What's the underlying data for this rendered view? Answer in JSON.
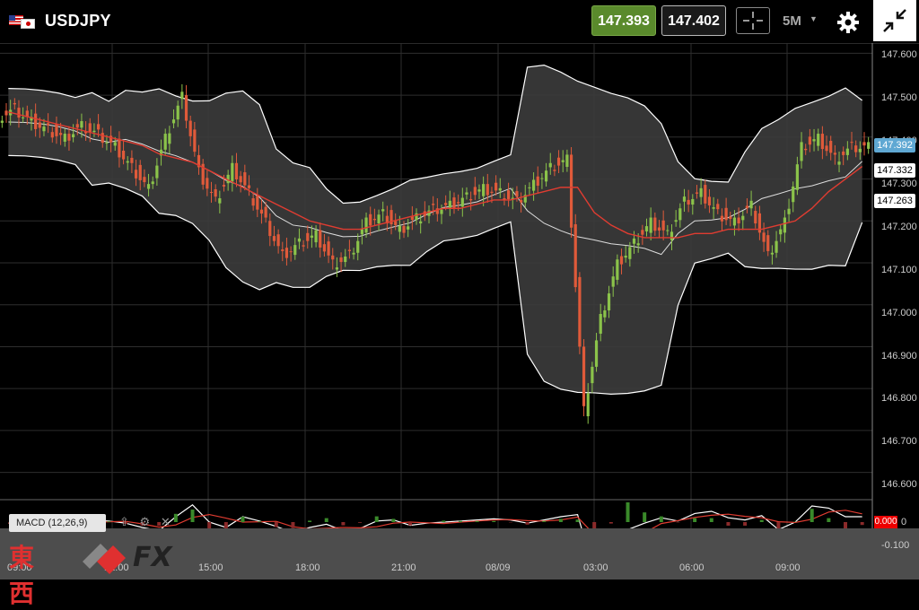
{
  "header": {
    "symbol": "USDJPY",
    "bid_price": "147.393",
    "ask_price": "147.402",
    "interval": "5M"
  },
  "price_axis": {
    "labels": [
      "147.600",
      "147.500",
      "147.400",
      "147.300",
      "147.200",
      "147.100",
      "147.000",
      "146.900",
      "146.800",
      "146.700",
      "146.600"
    ],
    "bid_tag": "147.392",
    "ma_tag": "147.332",
    "lower_band_tag": "147.263"
  },
  "macd": {
    "label": "MACD (12,26,9)",
    "axis_labels": [
      "0",
      "-0.100"
    ],
    "value_tag": "0.000"
  },
  "time_axis": {
    "labels": [
      "09:00",
      "12:00",
      "15:00",
      "18:00",
      "21:00",
      "08/09",
      "03:00",
      "06:00",
      "09:00"
    ]
  },
  "watermark": {
    "kanji": "東西",
    "fx": "FX"
  },
  "colors": {
    "bid": "#5a8a2c",
    "up_candle": "#8bc34a",
    "down_candle": "#e05a3a",
    "ma": "#e03c31",
    "band": "#ffffff"
  },
  "chart_data": {
    "type": "candlestick",
    "title": "USDJPY",
    "xlabel": "",
    "ylabel": "",
    "ylim": [
      146.55,
      147.62
    ],
    "indicators": [
      "Bollinger Bands",
      "Moving Average",
      "MACD (12,26,9)"
    ],
    "x": [
      "09:00",
      "09:30",
      "10:00",
      "10:30",
      "11:00",
      "11:30",
      "12:00",
      "12:30",
      "13:00",
      "13:30",
      "14:00",
      "14:30",
      "15:00",
      "15:30",
      "16:00",
      "16:30",
      "17:00",
      "17:30",
      "18:00",
      "18:30",
      "19:00",
      "19:30",
      "20:00",
      "20:30",
      "21:00",
      "21:30",
      "22:00",
      "22:30",
      "23:00",
      "23:30",
      "00:00",
      "00:30",
      "01:00",
      "01:30",
      "02:00",
      "02:30",
      "03:00",
      "03:30",
      "04:00",
      "04:30",
      "05:00",
      "05:30",
      "06:00",
      "06:30",
      "07:00",
      "07:30",
      "08:00",
      "08:30",
      "09:00",
      "09:30",
      "10:00",
      "10:30"
    ],
    "series": [
      {
        "values": [
          147.45,
          147.47,
          147.44,
          147.42,
          147.4,
          147.43,
          147.41,
          147.38,
          147.33,
          147.28,
          147.4,
          147.5,
          147.32,
          147.25,
          147.33,
          147.27,
          147.2,
          147.12,
          147.15,
          147.17,
          147.1,
          147.12,
          147.2,
          147.22,
          147.18,
          147.21,
          147.23,
          147.24,
          147.26,
          147.28,
          147.27,
          147.25,
          147.29,
          147.33,
          147.35,
          146.75,
          146.97,
          147.1,
          147.15,
          147.2,
          147.17,
          147.25,
          147.27,
          147.22,
          147.2,
          147.24,
          147.12,
          147.2,
          147.38,
          147.4,
          147.35,
          147.38
        ]
      },
      {
        "name": "MA",
        "values": [
          147.46,
          147.45,
          147.44,
          147.43,
          147.42,
          147.41,
          147.4,
          147.39,
          147.38,
          147.36,
          147.35,
          147.34,
          147.32,
          147.3,
          147.28,
          147.26,
          147.24,
          147.22,
          147.2,
          147.19,
          147.18,
          147.18,
          147.19,
          147.2,
          147.21,
          147.22,
          147.23,
          147.23,
          147.24,
          147.25,
          147.25,
          147.26,
          147.27,
          147.28,
          147.28,
          147.22,
          147.19,
          147.17,
          147.16,
          147.16,
          147.16,
          147.17,
          147.17,
          147.18,
          147.18,
          147.18,
          147.19,
          147.2,
          147.23,
          147.27,
          147.3,
          147.33
        ]
      }
    ]
  }
}
